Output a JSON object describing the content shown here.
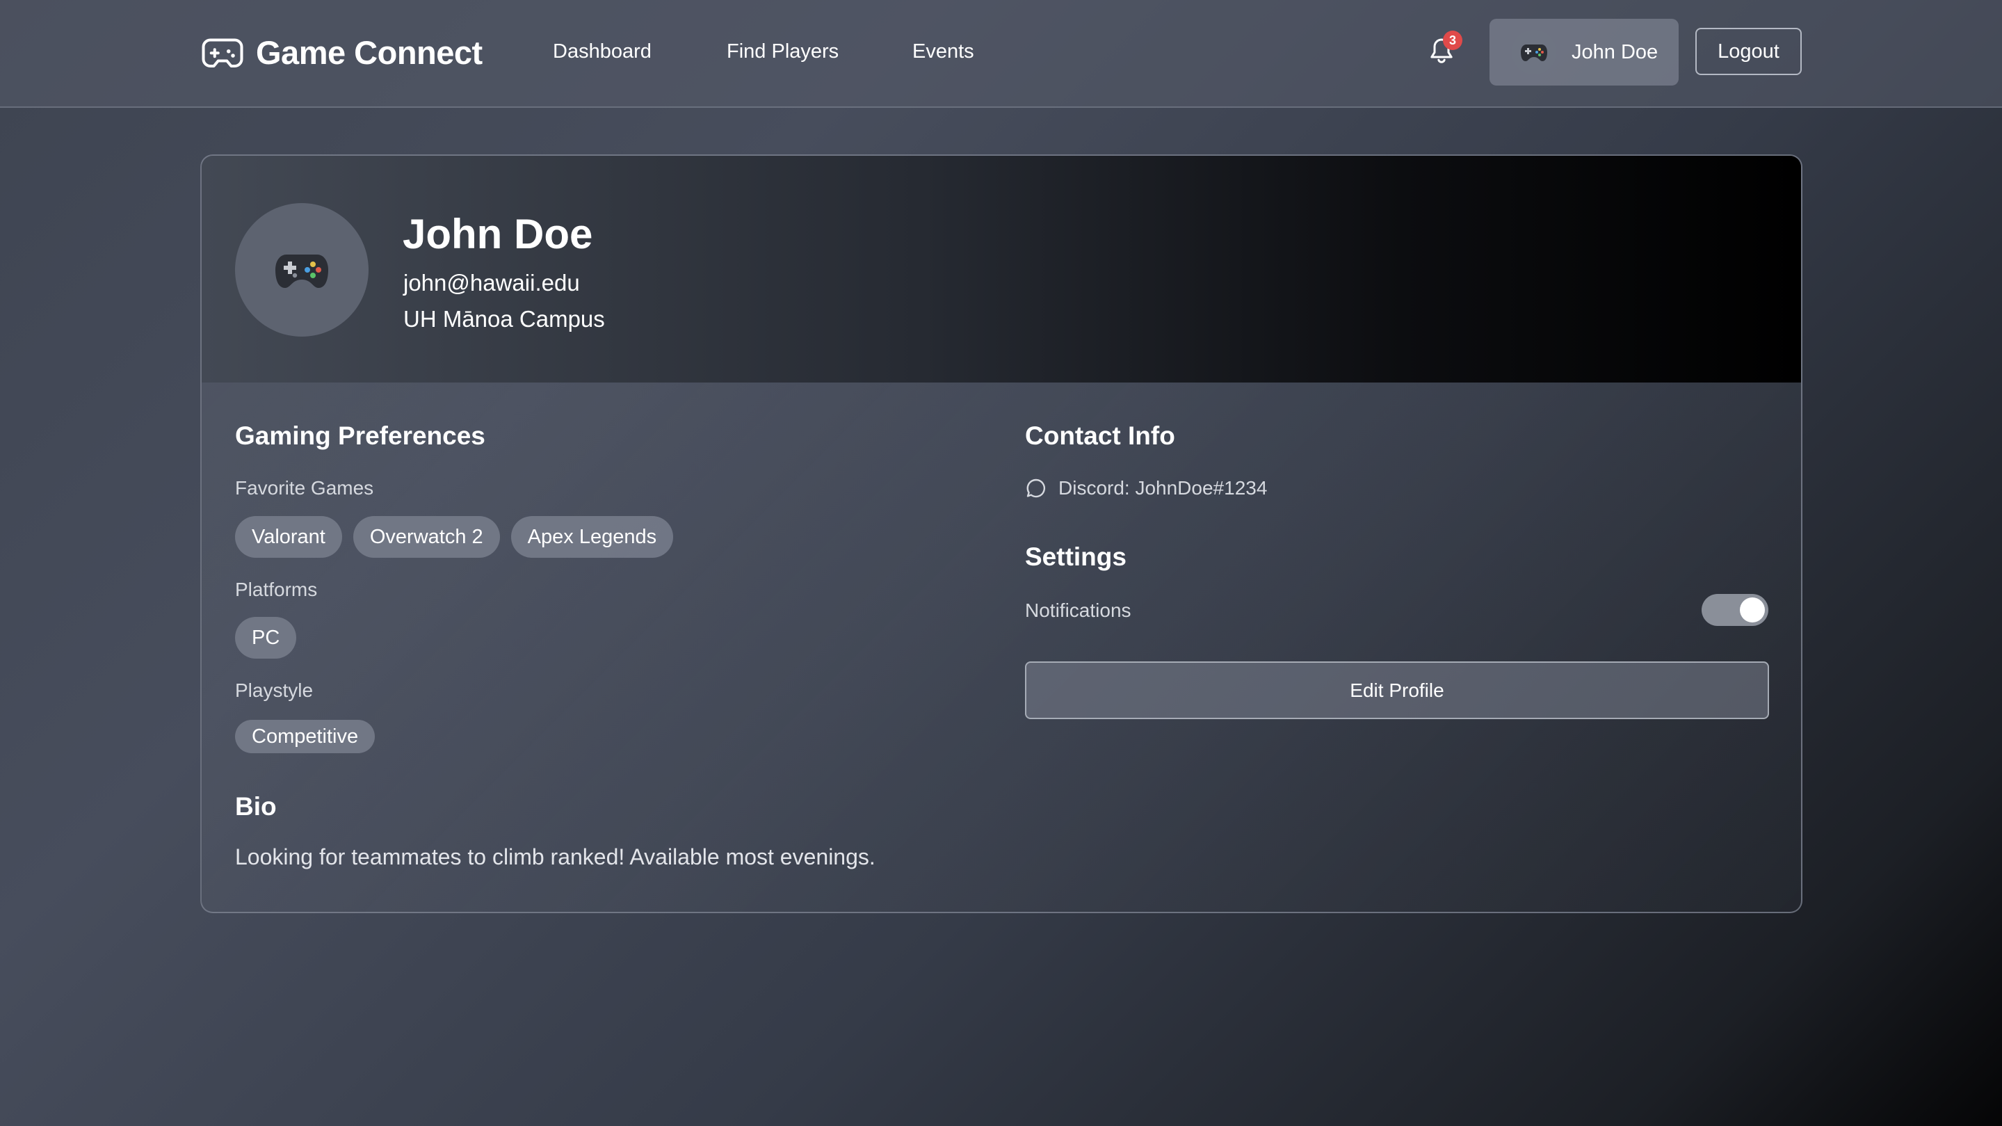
{
  "nav": {
    "brand": "Game Connect",
    "links": [
      "Dashboard",
      "Find Players",
      "Events"
    ],
    "notification_count": "3",
    "user_name": "John Doe",
    "logout_label": "Logout"
  },
  "profile": {
    "name": "John Doe",
    "email": "john@hawaii.edu",
    "campus": "UH Mānoa Campus",
    "avatar_icon": "gamepad-emoji"
  },
  "gaming_preferences": {
    "title": "Gaming Preferences",
    "favorite_games_label": "Favorite Games",
    "favorite_games": [
      "Valorant",
      "Overwatch 2",
      "Apex Legends"
    ],
    "platforms_label": "Platforms",
    "platforms": [
      "PC"
    ],
    "playstyle_label": "Playstyle",
    "playstyle": [
      "Competitive"
    ]
  },
  "bio": {
    "title": "Bio",
    "text": "Looking for teammates to climb ranked! Available most evenings."
  },
  "contact": {
    "title": "Contact Info",
    "discord": "Discord: JohnDoe#1234"
  },
  "settings": {
    "title": "Settings",
    "notifications_label": "Notifications",
    "notifications_enabled": true,
    "edit_profile_label": "Edit Profile"
  },
  "colors": {
    "badge": "#e04a4a",
    "toggle_on": "#8a8f99"
  }
}
